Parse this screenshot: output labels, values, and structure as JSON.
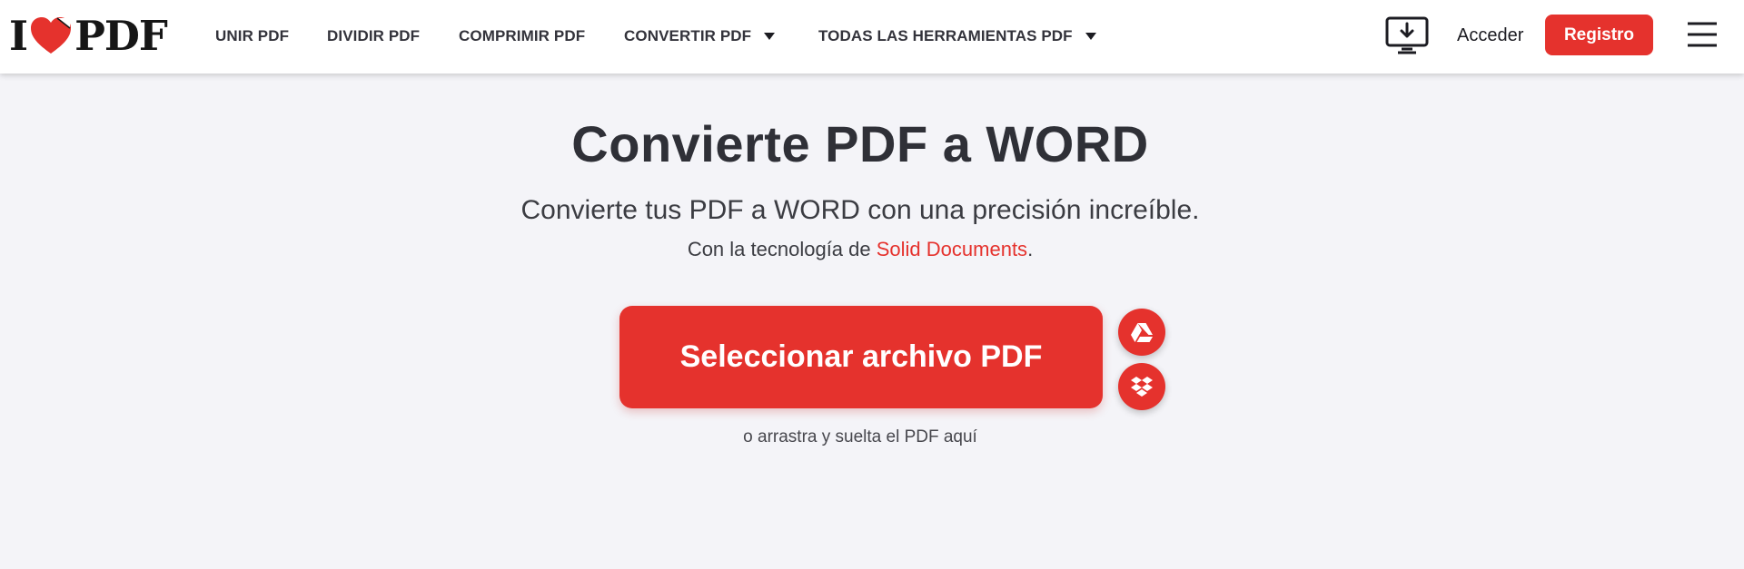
{
  "header": {
    "logo": {
      "left": "I",
      "right": "PDF"
    },
    "nav": [
      {
        "label": "UNIR PDF"
      },
      {
        "label": "DIVIDIR PDF"
      },
      {
        "label": "COMPRIMIR PDF"
      },
      {
        "label": "CONVERTIR PDF",
        "icon": "caret-down-icon"
      },
      {
        "label": "TODAS LAS HERRAMIENTAS PDF",
        "icon": "caret-down-icon"
      }
    ],
    "desktop_icon": "desktop-download-icon",
    "login_label": "Acceder",
    "signup_label": "Registro",
    "menu_icon": "hamburger-menu-icon"
  },
  "main": {
    "title": "Convierte PDF a WORD",
    "subtitle": "Convierte tus PDF a WORD con una precisión increíble.",
    "tech_prefix": "Con la tecnología de ",
    "tech_link": "Solid Documents",
    "tech_suffix": ".",
    "select_button": "Seleccionar archivo PDF",
    "cloud_buttons": [
      {
        "icon": "google-drive-icon"
      },
      {
        "icon": "dropbox-icon"
      }
    ],
    "drop_hint": "o arrastra y suelta el PDF aquí"
  },
  "colors": {
    "brand_red": "#e5322d",
    "background": "#f4f4f8",
    "text_dark": "#2f3037"
  }
}
